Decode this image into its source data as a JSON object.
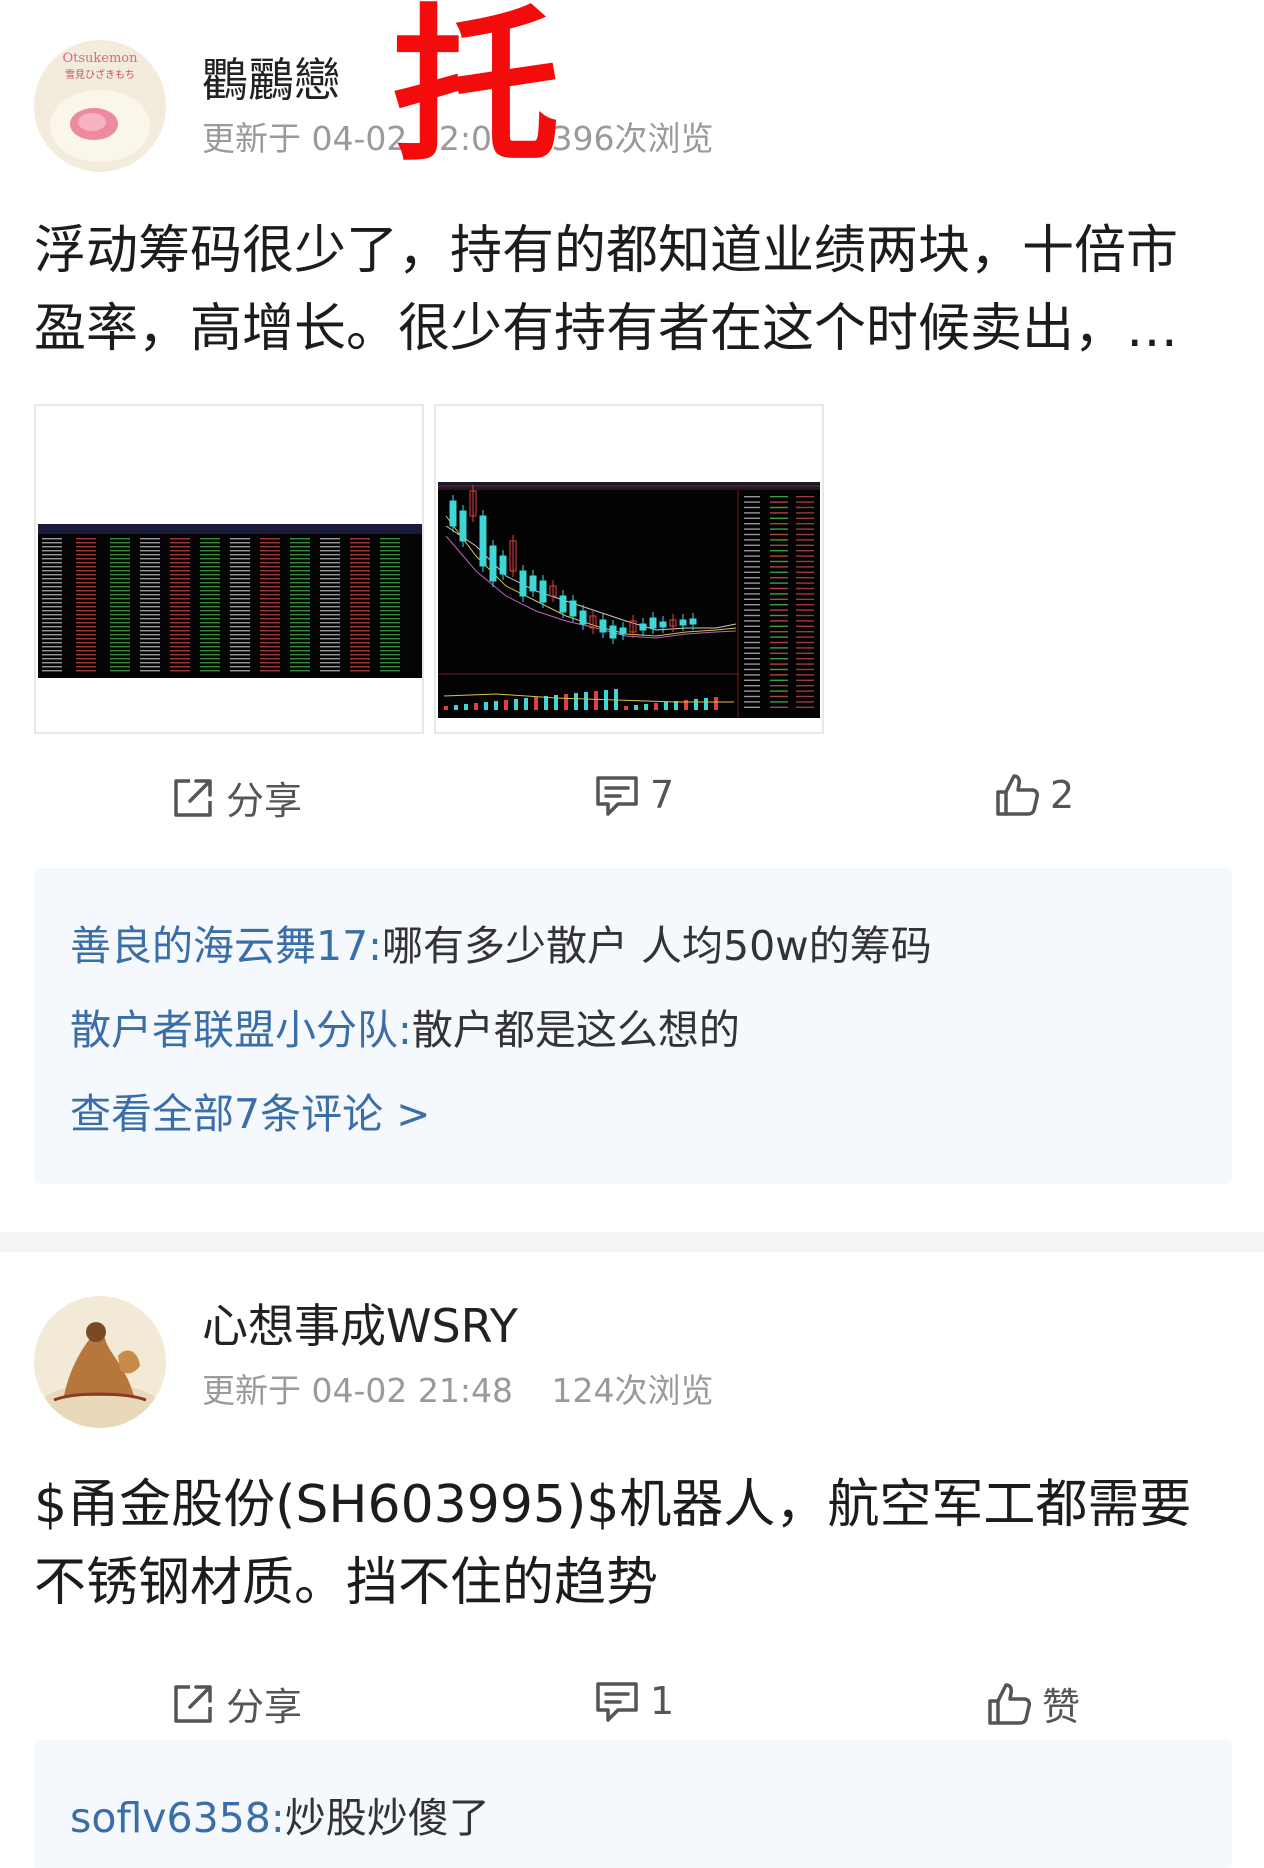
{
  "posts": [
    {
      "username": "鸜鸝戀",
      "update_time": "更新于 04-02 22:08",
      "views": "396次浏览",
      "stamp": "托",
      "content_lines": [
        "浮动筹码很少了，持有的都知道业绩两块，十倍市",
        "盈率，高增长。很少有持有者在这个时候卖出，…"
      ],
      "avatar_caption": "Otsukemon",
      "avatar_subcaption": "雪見ひざきもち",
      "actions": {
        "share": "分享",
        "comments": "7",
        "likes": "2"
      },
      "comments": [
        {
          "author": "善良的海云舞17:",
          "text": "哪有多少散户 人均50w的筹码"
        },
        {
          "author": "散户者联盟小分队:",
          "text": "散户都是这么想的"
        }
      ],
      "view_all": "查看全部7条评论 >"
    },
    {
      "username": "心想事成WSRY",
      "update_time": "更新于 04-02 21:48",
      "views": "124次浏览",
      "content_lines": [
        "$甬金股份(SH603995)$机器人，航空军工都需要",
        "不锈钢材质。挡不住的趋势"
      ],
      "actions": {
        "share": "分享",
        "comments": "1",
        "likes": "赞"
      },
      "comments": [
        {
          "author": "soflv6358:",
          "text": "炒股炒傻了"
        }
      ]
    }
  ],
  "colors": {
    "stamp_red": "#f40b0b",
    "link_blue": "#3a6ea8",
    "meta_gray": "#9a9a9a",
    "comment_bg": "#f5f8fc"
  },
  "icons": [
    "share-icon",
    "comment-icon",
    "thumbs-up-icon"
  ]
}
